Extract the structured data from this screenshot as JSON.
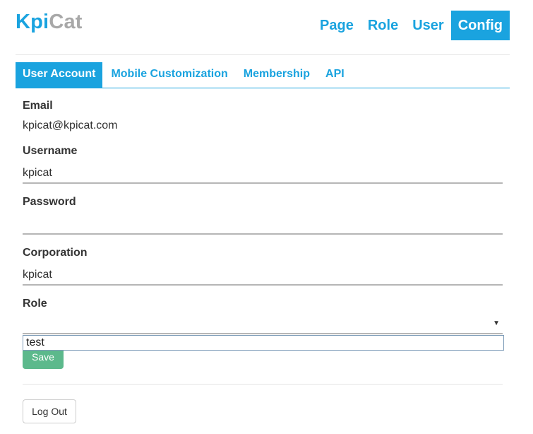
{
  "app": {
    "logo_part1": "Kpi",
    "logo_part2": "Cat",
    "brand_color": "#1aa3df"
  },
  "nav": {
    "items": [
      {
        "label": "Page",
        "active": false
      },
      {
        "label": "Role",
        "active": false
      },
      {
        "label": "User",
        "active": false
      },
      {
        "label": "Config",
        "active": true
      }
    ]
  },
  "tabs": {
    "items": [
      {
        "label": "User Account",
        "active": true
      },
      {
        "label": "Mobile Customization",
        "active": false
      },
      {
        "label": "Membership",
        "active": false
      },
      {
        "label": "API",
        "active": false
      }
    ]
  },
  "form": {
    "email_label": "Email",
    "email_value": "kpicat@kpicat.com",
    "username_label": "Username",
    "username_value": "kpicat",
    "password_label": "Password",
    "password_value": "",
    "corporation_label": "Corporation",
    "corporation_value": "kpicat",
    "role_label": "Role",
    "role_selected": "",
    "role_options": [
      "test"
    ],
    "save_label": "Save",
    "save_color": "#5cb98c"
  },
  "footer": {
    "logout_label": "Log Out"
  }
}
